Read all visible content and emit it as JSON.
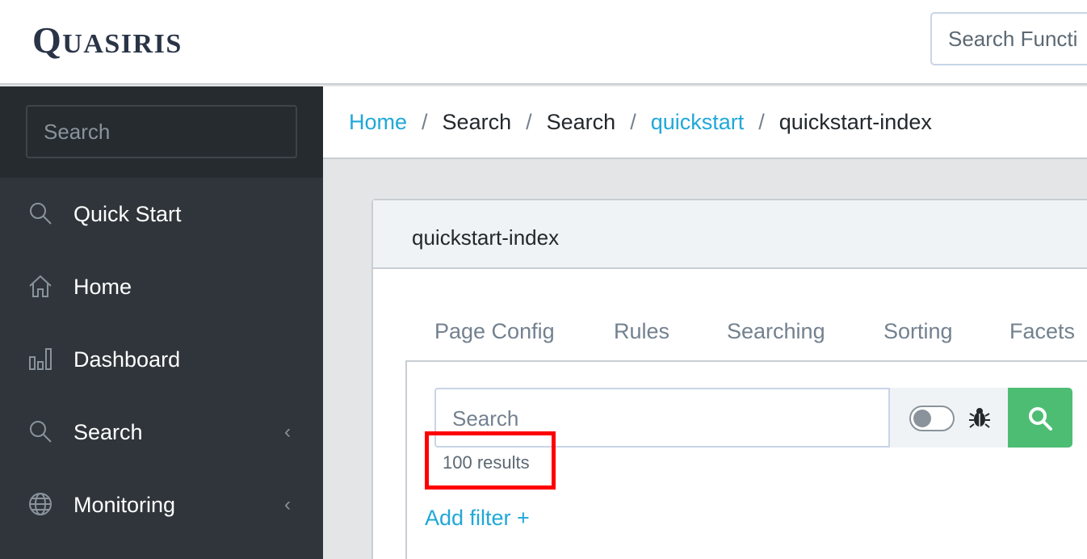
{
  "header": {
    "logo_first": "Q",
    "logo_rest": "UASIRIS",
    "search_placeholder": "Search Functi"
  },
  "sidebar": {
    "search_placeholder": "Search",
    "items": [
      {
        "label": "Quick Start",
        "icon": "search-icon"
      },
      {
        "label": "Home",
        "icon": "home-icon"
      },
      {
        "label": "Dashboard",
        "icon": "bar-chart-icon"
      },
      {
        "label": "Search",
        "icon": "search-icon",
        "chevron": "‹"
      },
      {
        "label": "Monitoring",
        "icon": "globe-icon",
        "chevron": "‹"
      }
    ]
  },
  "breadcrumb": {
    "items": [
      {
        "label": "Home",
        "link": true
      },
      {
        "label": "Search",
        "link": false
      },
      {
        "label": "Search",
        "link": false
      },
      {
        "label": "quickstart",
        "link": true
      },
      {
        "label": "quickstart-index",
        "link": false
      }
    ],
    "separator": "/"
  },
  "card": {
    "title": "quickstart-index",
    "tabs": [
      "Page Config",
      "Rules",
      "Searching",
      "Sorting",
      "Facets"
    ],
    "search_placeholder": "Search",
    "debug_toggle": "off",
    "results_text": "100 results",
    "add_filter_label": "Add filter +"
  },
  "colors": {
    "sidebar_bg": "#2f353a",
    "link": "#20a8d8",
    "search_button": "#4dbd74",
    "highlight": "#ff0000"
  }
}
